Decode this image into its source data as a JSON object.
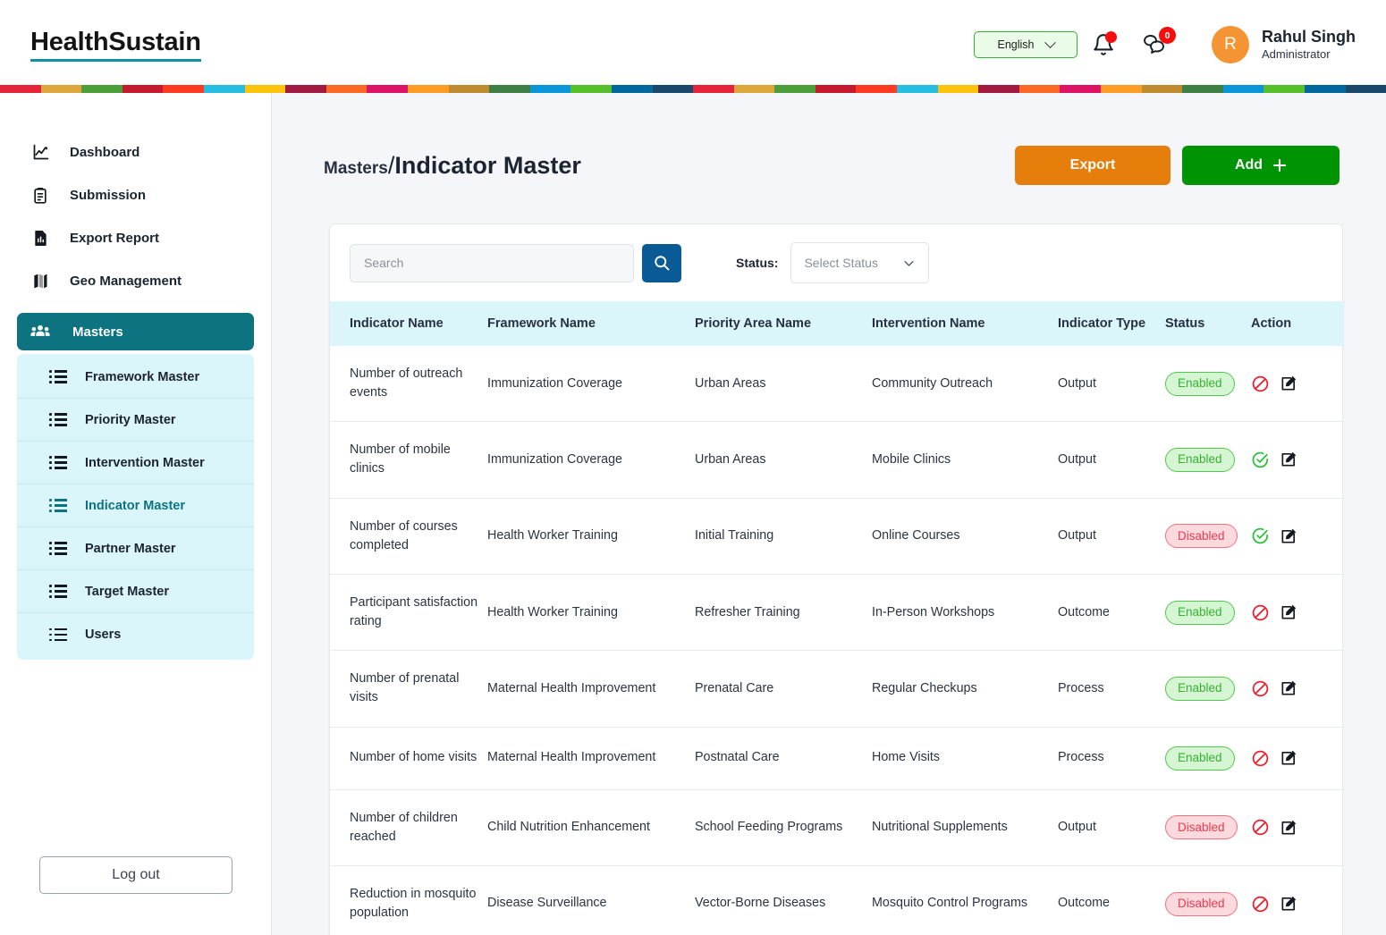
{
  "header": {
    "brand": "HealthSustain",
    "language": "English",
    "language_chevron_icon": "chevron-down-icon",
    "bell_icon": "bell-icon",
    "bell_has_dot": true,
    "chat_icon": "chat-bubbles-icon",
    "chat_badge": "0",
    "avatar_initial": "R",
    "user_name": "Rahul Singh",
    "user_role": "Administrator",
    "avatar_color": "#f59432"
  },
  "sdg_stripe": [
    "#e5243b",
    "#dda63a",
    "#4c9f38",
    "#c5192d",
    "#ff3a21",
    "#26bde2",
    "#fcc30b",
    "#a21942",
    "#fd6925",
    "#dd1367",
    "#fd9d24",
    "#bf8b2e",
    "#3f7e44",
    "#0a97d9",
    "#56c02b",
    "#00689d",
    "#19486a",
    "#e5243b",
    "#dda63a",
    "#4c9f38",
    "#c5192d",
    "#ff3a21",
    "#26bde2",
    "#fcc30b",
    "#a21942",
    "#fd6925",
    "#dd1367",
    "#fd9d24",
    "#bf8b2e",
    "#3f7e44",
    "#0a97d9",
    "#56c02b",
    "#00689d",
    "#19486a"
  ],
  "sidebar": {
    "items": [
      {
        "label": "Dashboard",
        "icon": "chart-line-icon"
      },
      {
        "label": "Submission",
        "icon": "clipboard-icon"
      },
      {
        "label": "Export Report",
        "icon": "report-bars-icon"
      },
      {
        "label": "Geo Management",
        "icon": "map-icon"
      }
    ],
    "masters": {
      "label": "Masters",
      "icon": "people-group-icon",
      "active": true
    },
    "submenu": [
      {
        "label": "Framework Master",
        "active": false
      },
      {
        "label": "Priority Master",
        "active": false
      },
      {
        "label": "Intervention Master",
        "active": false
      },
      {
        "label": "Indicator Master",
        "active": true
      },
      {
        "label": "Partner Master",
        "active": false
      },
      {
        "label": "Target Master",
        "active": false
      },
      {
        "label": "Users",
        "active": false
      }
    ],
    "logout": "Log out",
    "active_color": "#0d7380",
    "submenu_bg": "#dbf6fb"
  },
  "main": {
    "breadcrumb": "Masters",
    "breadcrumb_separator": "/",
    "title": "Indicator Master",
    "export_label": "Export",
    "add_label": "Add",
    "add_plus_icon": "plus-icon",
    "export_color": "#e57e0a",
    "add_color": "#009405"
  },
  "filters": {
    "search_value": "",
    "search_placeholder": "Search",
    "search_button_icon": "search-icon",
    "status_label": "Status:",
    "status_value": "Select Status",
    "status_chevron_icon": "chevron-down-icon"
  },
  "table": {
    "columns": [
      "Indicator Name",
      "Framework Name",
      "Priority Area Name",
      "Intervention Name",
      "Indicator Type",
      "Status",
      "Action"
    ],
    "rows": [
      {
        "indicator": "Number of outreach events",
        "framework": "Immunization Coverage",
        "priority": "Urban Areas",
        "intervention": "Community Outreach",
        "type": "Output",
        "status": "Enabled",
        "toggle_icon": "ban-icon",
        "edit_icon": "edit-square-icon"
      },
      {
        "indicator": "Number of mobile clinics",
        "framework": "Immunization Coverage",
        "priority": "Urban Areas",
        "intervention": "Mobile Clinics",
        "type": "Output",
        "status": "Enabled",
        "toggle_icon": "check-circle-icon",
        "edit_icon": "edit-square-icon"
      },
      {
        "indicator": "Number of courses completed",
        "framework": "Health Worker Training",
        "priority": "Initial Training",
        "intervention": "Online Courses",
        "type": "Output",
        "status": "Disabled",
        "toggle_icon": "check-circle-icon",
        "edit_icon": "edit-square-icon"
      },
      {
        "indicator": "Participant satisfaction rating",
        "framework": "Health Worker Training",
        "priority": "Refresher Training",
        "intervention": "In-Person Workshops",
        "type": "Outcome",
        "status": "Enabled",
        "toggle_icon": "ban-icon",
        "edit_icon": "edit-square-icon"
      },
      {
        "indicator": "Number of prenatal visits",
        "framework": "Maternal Health Improvement",
        "priority": "Prenatal Care",
        "intervention": "Regular Checkups",
        "type": "Process",
        "status": "Enabled",
        "toggle_icon": "ban-icon",
        "edit_icon": "edit-square-icon"
      },
      {
        "indicator": "Number of home visits",
        "framework": "Maternal Health Improvement",
        "priority": "Postnatal Care",
        "intervention": "Home Visits",
        "type": "Process",
        "status": "Enabled",
        "toggle_icon": "ban-icon",
        "edit_icon": "edit-square-icon"
      },
      {
        "indicator": "Number of children reached",
        "framework": "Child Nutrition Enhancement",
        "priority": "School Feeding Programs",
        "intervention": "Nutritional Supplements",
        "type": "Output",
        "status": "Disabled",
        "toggle_icon": "ban-icon",
        "edit_icon": "edit-square-icon"
      },
      {
        "indicator": "Reduction in mosquito population",
        "framework": "Disease Surveillance",
        "priority": "Vector-Borne Diseases",
        "intervention": "Mosquito Control Programs",
        "type": "Outcome",
        "status": "Disabled",
        "toggle_icon": "ban-icon",
        "edit_icon": "edit-square-icon"
      }
    ]
  }
}
